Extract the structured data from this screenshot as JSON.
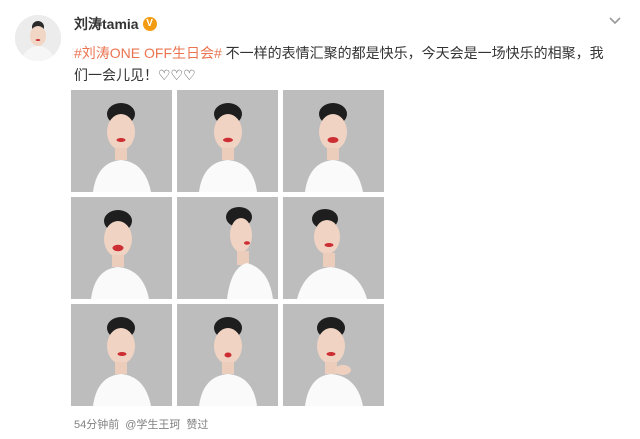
{
  "post": {
    "author": "刘涛tamia",
    "verified_badge": "V",
    "hashtag": "#刘涛ONE OFF生日会#",
    "body": " 不一样的表情汇聚的都是快乐，今天会是一场快乐的相聚，我们一会儿见！♡♡♡",
    "time": "54分钟前",
    "via": "@学生王珂",
    "via_suffix": "赞过"
  },
  "photos": [
    {
      "pose": "smile-left"
    },
    {
      "pose": "smile-front"
    },
    {
      "pose": "laugh-front"
    },
    {
      "pose": "laugh-tilt"
    },
    {
      "pose": "profile-right"
    },
    {
      "pose": "tilt-shoulder"
    },
    {
      "pose": "wink"
    },
    {
      "pose": "pout"
    },
    {
      "pose": "hand-chin"
    }
  ],
  "icons": {
    "menu": "chevron-down-icon",
    "verified": "verified-badge-icon"
  },
  "colors": {
    "hashtag": "#eb7350",
    "badge": "#f39c12",
    "meta": "#808080"
  }
}
